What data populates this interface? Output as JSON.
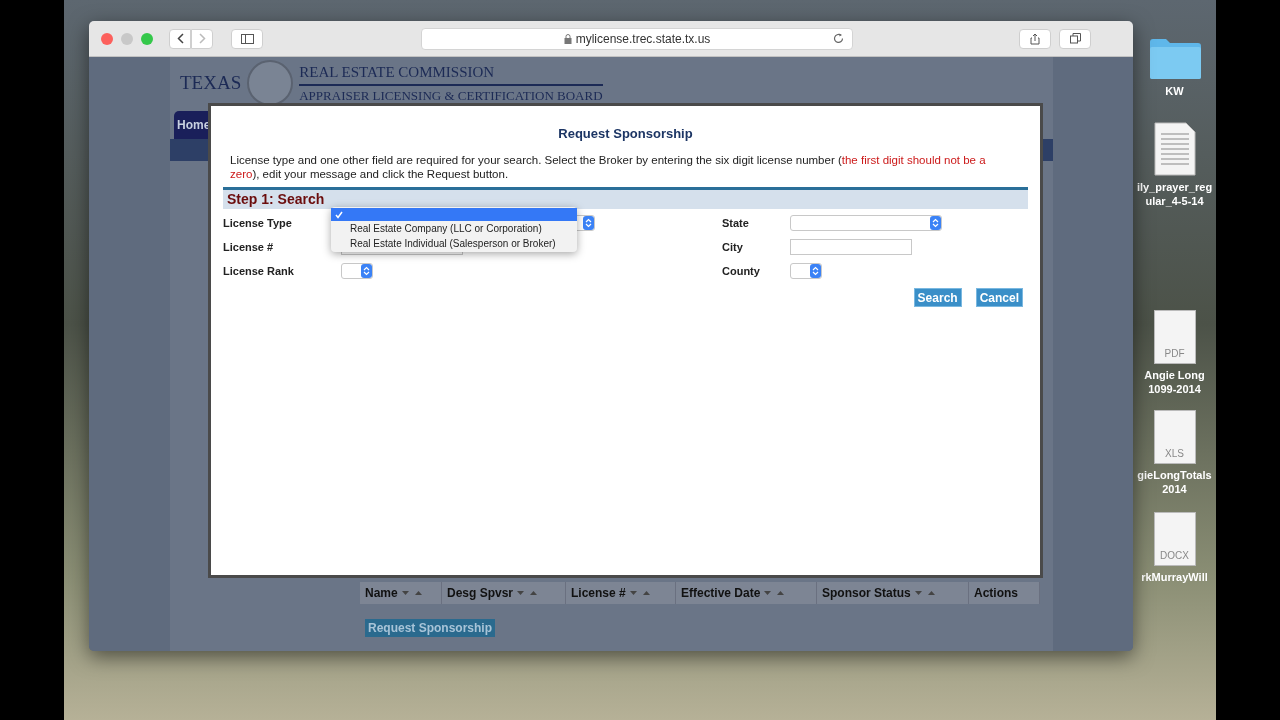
{
  "browser": {
    "url": "mylicense.trec.state.tx.us"
  },
  "background_page": {
    "logo_text": "TEXAS",
    "title": "REAL ESTATE COMMISSION",
    "subtitle": "APPRAISER LICENSING & CERTIFICATION BOARD",
    "nav_tab": "Home",
    "table": {
      "columns": [
        "Name",
        "Desg Spvsr",
        "License #",
        "Effective Date",
        "Sponsor Status",
        "Actions"
      ],
      "sortable": [
        true,
        true,
        true,
        true,
        true,
        false
      ]
    },
    "button": "Request Sponsorship"
  },
  "dialog": {
    "title": "Request Sponsorship",
    "instructions": "License type and one other field are required for your search. Select the Broker by entering the six digit license number (",
    "warning": "the first digit should not be a zero",
    "instructions_end": "), edit your message and click the Request button.",
    "step": "Step 1: Search",
    "left_fields": [
      {
        "label": "License Type",
        "kind": "dropdown"
      },
      {
        "label": "License #",
        "kind": "text"
      },
      {
        "label": "License Rank",
        "kind": "small-select"
      }
    ],
    "right_fields": [
      {
        "label": "State",
        "kind": "select"
      },
      {
        "label": "City",
        "kind": "text"
      },
      {
        "label": "County",
        "kind": "small-select"
      }
    ],
    "open_menu": {
      "blank_checked": true,
      "options": [
        {
          "label": "Real Estate Company (LLC or Corporation)",
          "selected": false
        },
        {
          "label": "Real Estate Individual (Salesperson or Broker)",
          "selected": false
        }
      ]
    },
    "buttons": [
      "Search",
      "Cancel"
    ]
  },
  "desktop_icons": [
    {
      "kind": "folder",
      "lines": [
        "KW"
      ]
    },
    {
      "kind": "doc",
      "lines": [
        "ily_prayer_reg",
        "ular_4-5-14"
      ]
    },
    {
      "kind": "file",
      "badge": "PDF",
      "lines": [
        "Angie Long",
        "1099-2014"
      ]
    },
    {
      "kind": "file",
      "badge": "XLS",
      "lines": [
        "gieLongTotals",
        "2014"
      ]
    },
    {
      "kind": "file",
      "badge": "DOCX",
      "lines": [
        "rkMurrayWill"
      ]
    }
  ]
}
